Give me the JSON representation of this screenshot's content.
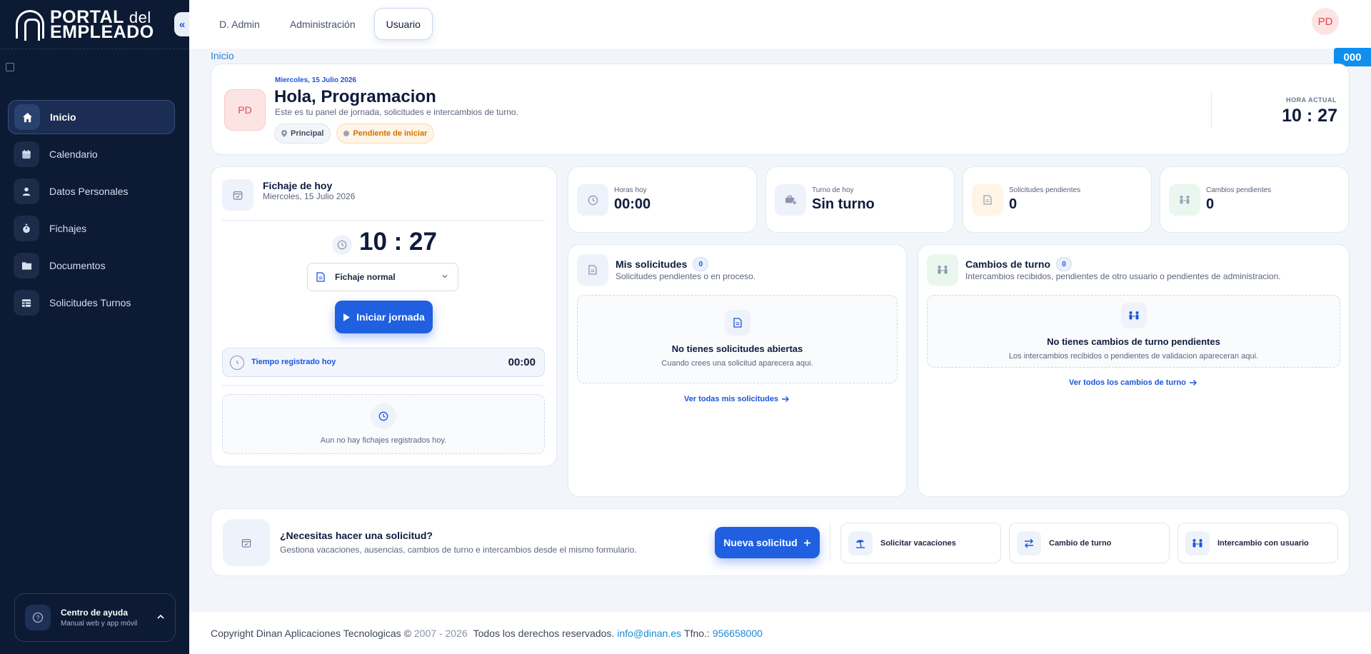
{
  "brand": {
    "logo_line1": "PORTAL",
    "logo_del": "del",
    "logo_line2": "EMPLEADO"
  },
  "sidebar": {
    "items": [
      {
        "label": "Inicio",
        "icon": "home-icon",
        "active": true
      },
      {
        "label": "Calendario",
        "icon": "calendar-icon"
      },
      {
        "label": "Datos Personales",
        "icon": "user-icon"
      },
      {
        "label": "Fichajes",
        "icon": "stopwatch-icon"
      },
      {
        "label": "Documentos",
        "icon": "folder-icon"
      },
      {
        "label": "Solicitudes Turnos",
        "icon": "table-icon"
      }
    ],
    "help": {
      "title": "Centro de ayuda",
      "subtitle": "Manual web y app móvil"
    }
  },
  "topbar": {
    "tabs": [
      {
        "label": "D. Admin"
      },
      {
        "label": "Administración"
      },
      {
        "label": "Usuario",
        "active": true
      }
    ],
    "avatar": "PD"
  },
  "breadcrumb": "Inicio",
  "fps_counter": "000",
  "header": {
    "avatar": "PD",
    "date": "Miercoles, 15 Julio 2026",
    "greeting": "Hola, Programacion",
    "subtitle": "Este es tu panel de jornada, solicitudes e intercambios de turno.",
    "chip_location": "Principal",
    "chip_status": "Pendiente de iniciar",
    "time_label": "HORA ACTUAL",
    "time_value": "10 : 27"
  },
  "fichaje": {
    "title": "Fichaje de hoy",
    "date": "Miercoles, 15 Julio 2026",
    "clock": "10 : 27",
    "type_selected": "Fichaje normal",
    "start_button": "Iniciar jornada",
    "registered_label": "Tiempo registrado hoy",
    "registered_value": "00:00",
    "empty_text": "Aun no hay fichajes registrados hoy."
  },
  "stats": [
    {
      "label": "Horas hoy",
      "value": "00:00",
      "icon": "clock-icon",
      "color": "#eef2fa"
    },
    {
      "label": "Turno de hoy",
      "value": "Sin turno",
      "icon": "briefcase-icon",
      "color": "#eef2fa"
    },
    {
      "label": "Solicitudes pendientes",
      "value": "0",
      "icon": "document-icon",
      "color": "#fff4e6"
    },
    {
      "label": "Cambios pendientes",
      "value": "0",
      "icon": "people-icon",
      "color": "#e9f7ef"
    }
  ],
  "solicitudes": {
    "title": "Mis solicitudes",
    "count": "0",
    "subtitle": "Solicitudes pendientes o en proceso.",
    "empty_title": "No tienes solicitudes abiertas",
    "empty_sub": "Cuando crees una solicitud aparecera aqui.",
    "link": "Ver todas mis solicitudes"
  },
  "cambios": {
    "title": "Cambios de turno",
    "count": "0",
    "subtitle": "Intercambios recibidos, pendientes de otro usuario o pendientes de administracion.",
    "empty_title": "No tienes cambios de turno pendientes",
    "empty_sub": "Los intercambios recibidos o pendientes de validacion apareceran aqui.",
    "link": "Ver todos los cambios de turno"
  },
  "request_bar": {
    "title": "¿Necesitas hacer una solicitud?",
    "subtitle": "Gestiona vacaciones, ausencias, cambios de turno e intercambios desde el mismo formulario.",
    "new_button": "Nueva solicitud",
    "quick_actions": [
      {
        "label": "Solicitar vacaciones",
        "icon": "beach-icon"
      },
      {
        "label": "Cambio de turno",
        "icon": "swap-icon"
      },
      {
        "label": "Intercambio con usuario",
        "icon": "people-icon"
      }
    ]
  },
  "footer": {
    "copyright": "Copyright Dinan Aplicaciones Tecnologicas ©",
    "years": "2007 - 2026",
    "rights": "Todos los derechos reservados.",
    "email": "info@dinan.es",
    "phone_label": "Tfno.:",
    "phone": "956658000"
  }
}
